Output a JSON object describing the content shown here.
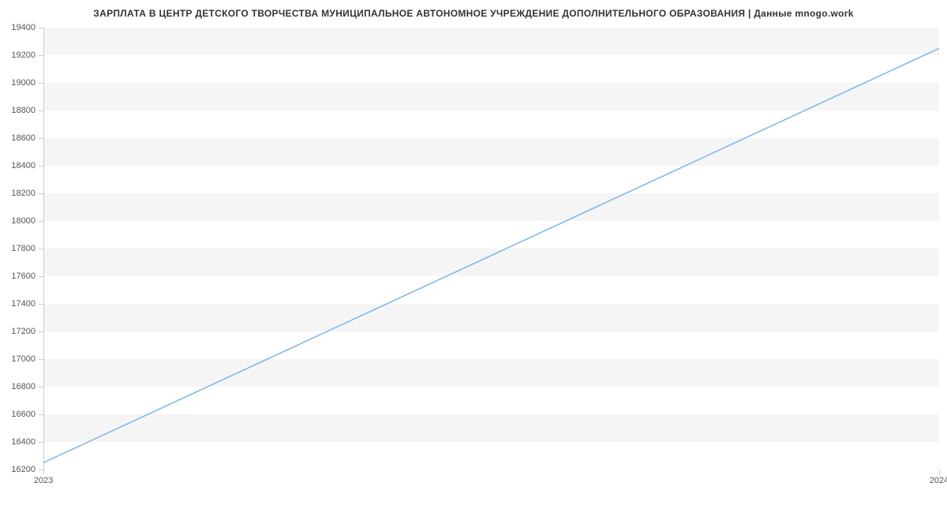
{
  "chart_data": {
    "type": "line",
    "title": "ЗАРПЛАТА В ЦЕНТР ДЕТСКОГО ТВОРЧЕСТВА МУНИЦИПАЛЬНОЕ АВТОНОМНОЕ УЧРЕЖДЕНИЕ ДОПОЛНИТЕЛЬНОГО ОБРАЗОВАНИЯ | Данные mnogo.work",
    "x": [
      2023,
      2024
    ],
    "values": [
      16250,
      19250
    ],
    "xlabel": "",
    "ylabel": "",
    "ylim": [
      16200,
      19400
    ],
    "y_ticks": [
      16200,
      16400,
      16600,
      16800,
      17000,
      17200,
      17400,
      17600,
      17800,
      18000,
      18200,
      18400,
      18600,
      18800,
      19000,
      19200,
      19400
    ],
    "x_ticks": [
      2023,
      2024
    ],
    "line_color": "#7cb5ec",
    "band_color": "#f5f5f5"
  }
}
